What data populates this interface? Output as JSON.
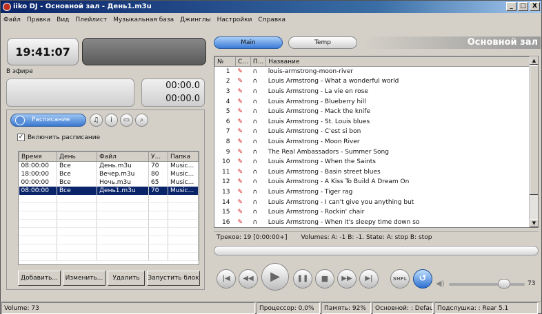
{
  "window": {
    "title": "iiko DJ - Основной зал - День1.m3u",
    "btn_min": "_",
    "btn_max": "□",
    "btn_close": "X"
  },
  "menu": [
    "Файл",
    "Правка",
    "Вид",
    "Плейлист",
    "Музыкальная база",
    "Джинглы",
    "Настройки",
    "Справка"
  ],
  "left": {
    "clock": "19:41:07",
    "onair_label": "В эфире",
    "time1": "00:00.0",
    "time2": "00:00.0",
    "schedule_tab": "Расписание",
    "enable_label": "Включить расписание",
    "enable_checked": true,
    "columns": [
      "Время",
      "День",
      "Файл",
      "У...",
      "Папка"
    ],
    "rows": [
      [
        "08:00:00",
        "Все",
        "День.m3u",
        "70",
        "Music..."
      ],
      [
        "18:00:00",
        "Все",
        "Вечер.m3u",
        "80",
        "Music..."
      ],
      [
        "00:00:00",
        "Все",
        "Ночь.m3u",
        "65",
        "Music..."
      ],
      [
        "08:00:00",
        "Все",
        "День1.m3u",
        "70",
        "Music..."
      ]
    ],
    "selected_row": 3,
    "buttons": {
      "add": "Добавить...",
      "edit": "Изменить...",
      "delete": "Удалить",
      "run": "Запустить блок"
    }
  },
  "tabs": {
    "main": "Main",
    "temp": "Temp"
  },
  "hall_title": "Основной зал",
  "playlist": {
    "columns": [
      "№",
      "С...",
      "П...",
      "Название"
    ],
    "items": [
      "louis-armstrong-moon-river",
      "Louis Armstrong - What a wonderful world",
      "Louis Armstrong - La vie en rose",
      "Louis Armstrong - Blueberry hill",
      "Louis Armstrong - Mack the knife",
      "Louis Armstrong - St. Louis blues",
      "Louis Armstrong - C'est si bon",
      "Louis Armstrong - Moon River",
      "The Real Ambassadors - Summer Song",
      "Louis Armstrong - When the Saints",
      "Louis Armstrong - Basin street blues",
      "Louis Armstrong - A Kiss To Build A Dream On",
      "Louis Armstrong - Tiger rag",
      "Louis Armstrong - I can't give you anything but",
      "Louis Armstrong - Rockin' chair",
      "Louis Armstrong - When it's sleepy  time down so"
    ],
    "tracks_info": "Треков: 19 [0:00:00+]",
    "volumes_info": "Volumes: A: -1 B: -1. State: A: stop B: stop"
  },
  "player": {
    "shfl": "SHFL",
    "volume_value": "73",
    "volume_level": 0.73
  },
  "statusbar": {
    "volume": "Volume: 73",
    "cpu": "Процессор: 0,0%",
    "memory": "Память: 92%",
    "main_dev": "Основной: : Default",
    "monitor_dev": "Подслушка: : Rear 5.1"
  }
}
